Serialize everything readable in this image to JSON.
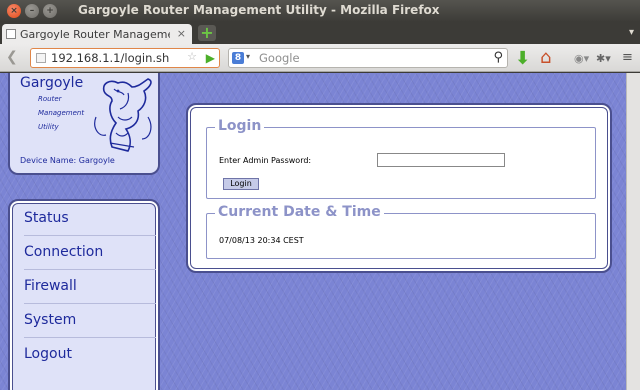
{
  "window": {
    "title": "Gargoyle Router Management Utility - Mozilla Firefox",
    "close_glyph": "×",
    "min_glyph": "–",
    "max_glyph": "+"
  },
  "tab": {
    "label": "Gargoyle Router Management ...",
    "close_glyph": "×",
    "new_tab_glyph": "+",
    "list_glyph": "▾"
  },
  "nav": {
    "url": "192.168.1.1/login.sh",
    "search_placeholder": "Google",
    "back_glyph": "❮",
    "go_glyph": "▶",
    "star_glyph": "☆",
    "search_glyph": "⚲",
    "download_glyph": "⬇",
    "home_glyph": "⌂",
    "g_glyph": "8",
    "drop_glyph": "▾"
  },
  "logo": {
    "title": "Gargoyle",
    "sub1": "Router",
    "sub2": "Management",
    "sub3": "Utility",
    "device_name": "Device Name:  Gargoyle"
  },
  "menu": {
    "items": [
      "Status",
      "Connection",
      "Firewall",
      "System",
      "Logout"
    ]
  },
  "login": {
    "legend": "Login",
    "password_label": "Enter Admin Password:",
    "button": "Login"
  },
  "datetime": {
    "legend": "Current Date & Time",
    "value": "07/08/13 20:34 CEST"
  },
  "colors": {
    "page_bg": "#7b84d4",
    "accent": "#1e2a9c",
    "legend": "#8d93c8"
  }
}
